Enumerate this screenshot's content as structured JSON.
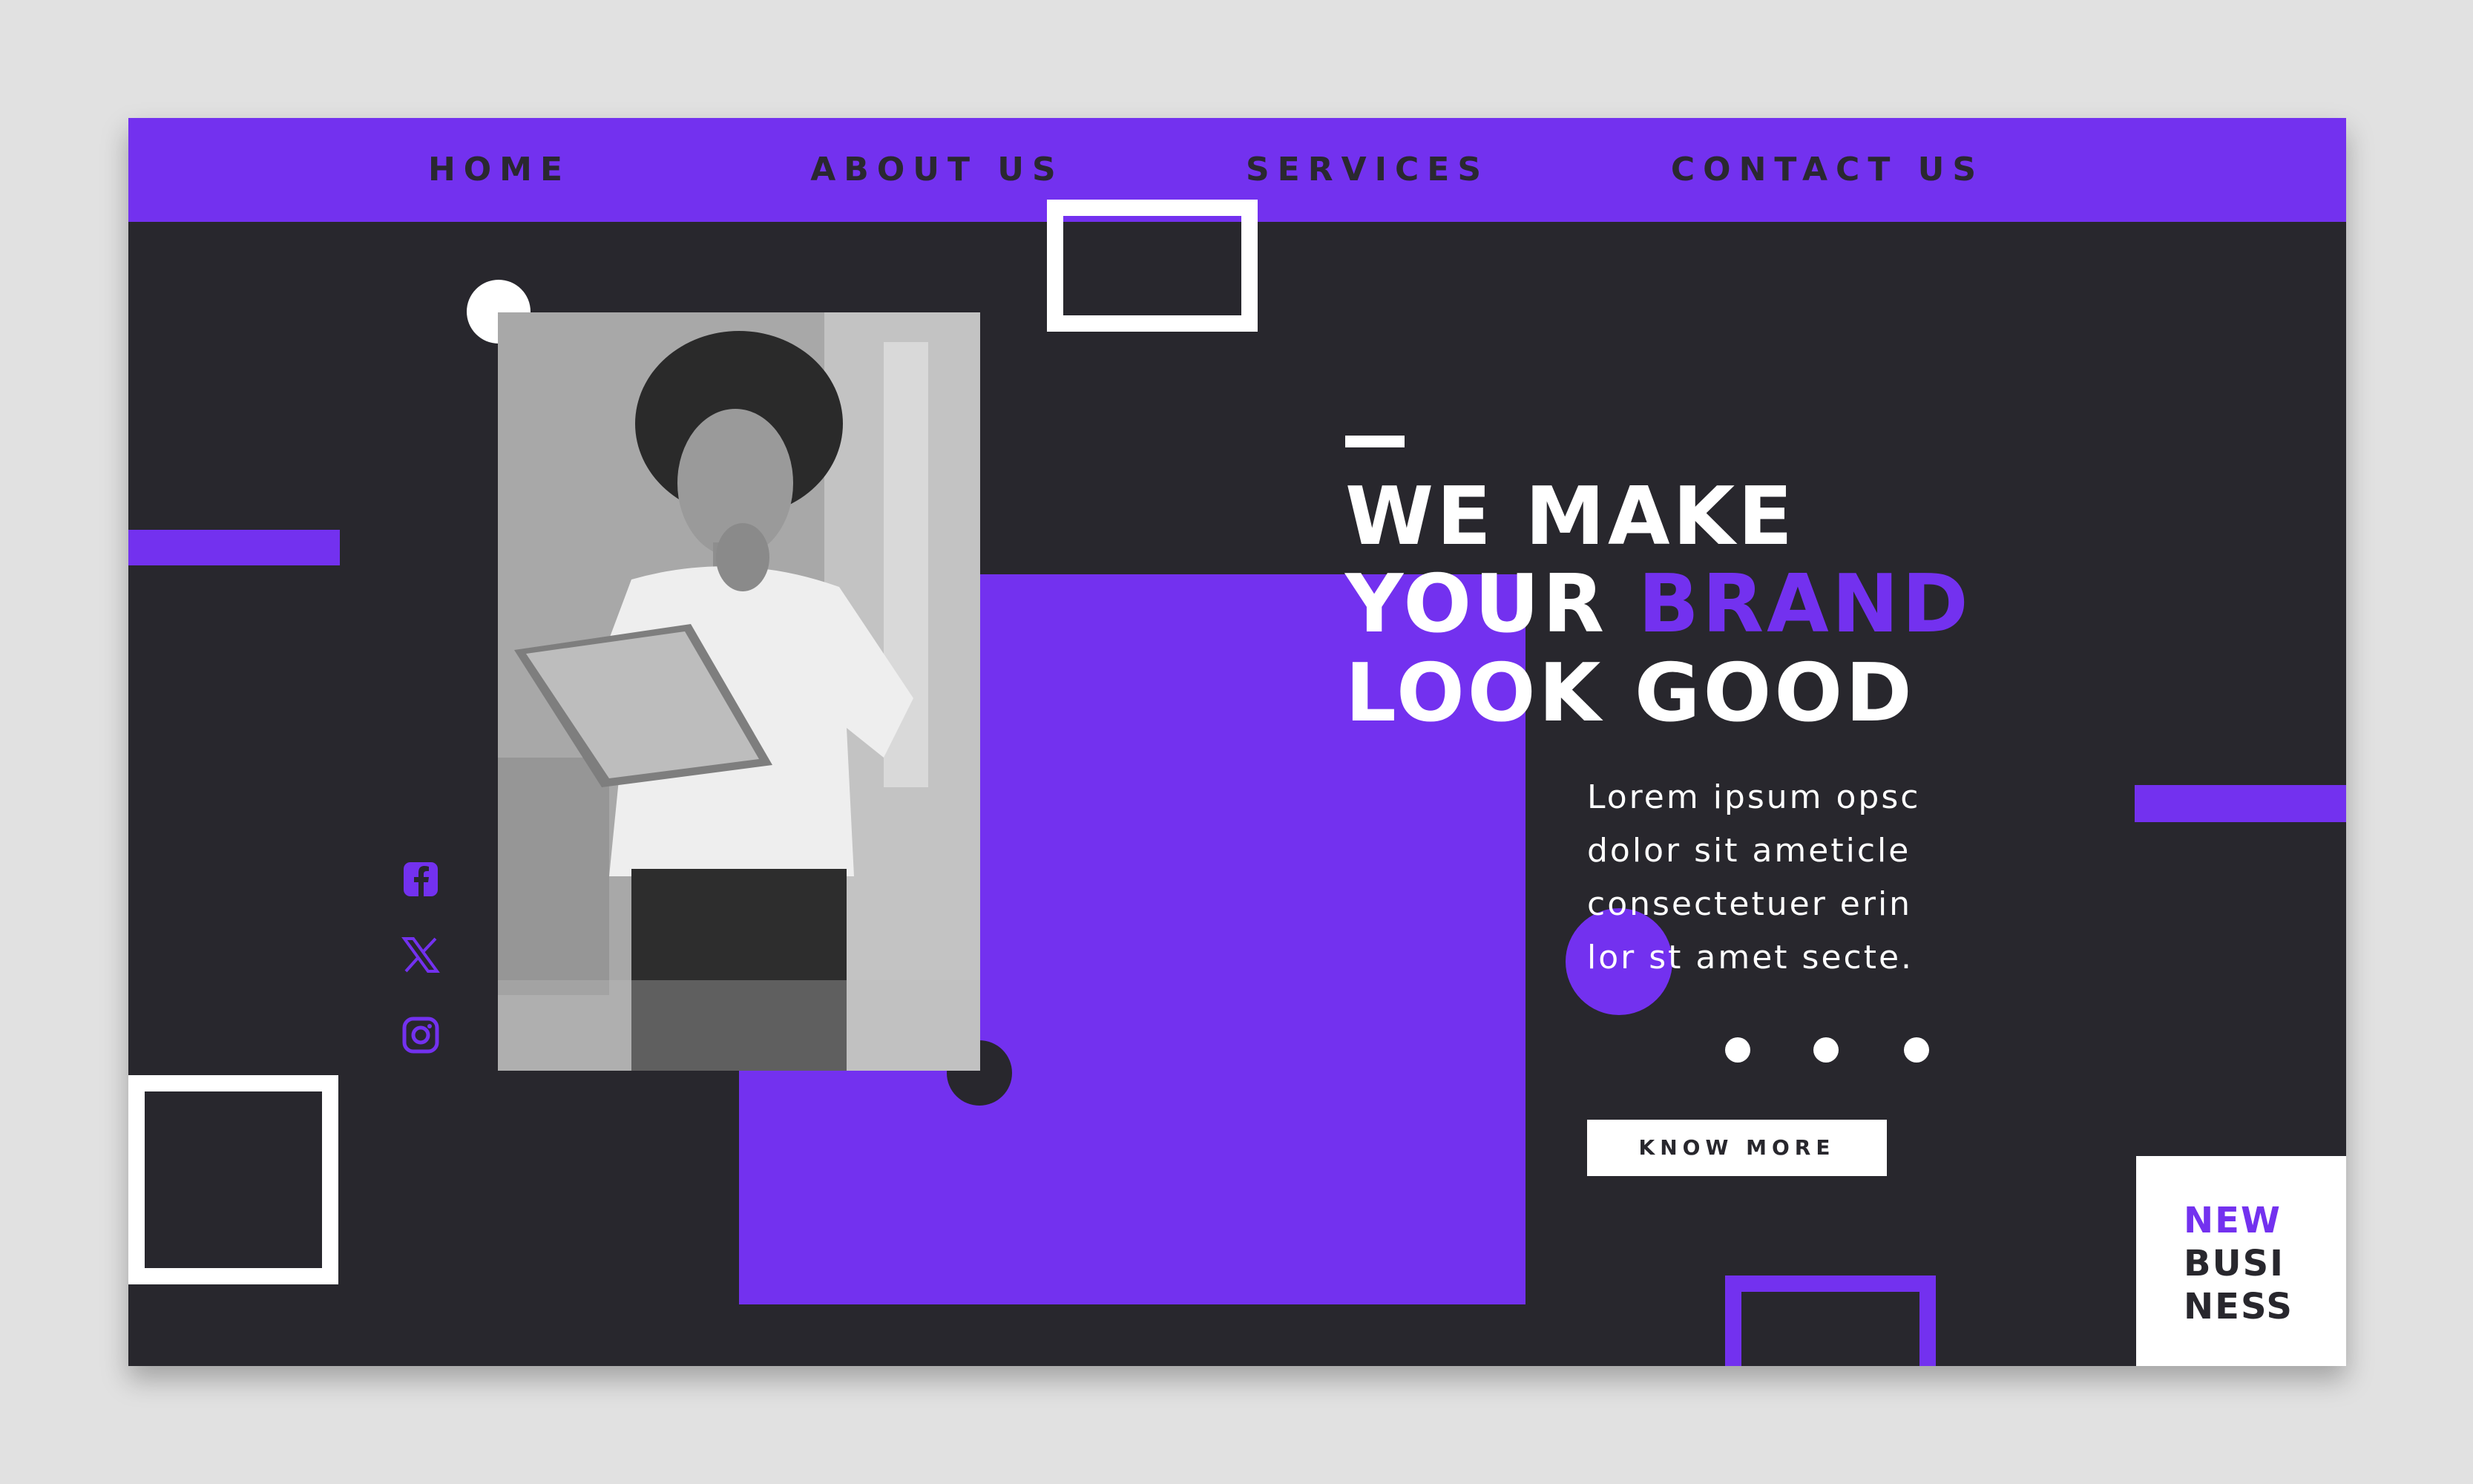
{
  "nav": {
    "items": [
      {
        "label": "HOME"
      },
      {
        "label": "ABOUT US"
      },
      {
        "label": "SERVICES"
      },
      {
        "label": "CONTACT US"
      }
    ]
  },
  "hero": {
    "headline_line1": "WE MAKE",
    "headline_line2_part1": "YOUR",
    "headline_line2_accent": "BRAND",
    "headline_line3": "LOOK GOOD",
    "body_lines": [
      "Lorem ipsum opsc",
      "dolor sit ameticle",
      "consectetuer erin",
      "lor st amet secte."
    ],
    "cta_label": "KNOW MORE"
  },
  "badge": {
    "line1": "NEW",
    "line2": "BUSI",
    "line3": "NESS"
  },
  "social": {
    "icons": [
      "facebook-icon",
      "x-icon",
      "instagram-icon"
    ]
  },
  "colors": {
    "accent": "#7331ef",
    "background": "#28272d",
    "page": "#e1e1e1",
    "white": "#ffffff"
  }
}
